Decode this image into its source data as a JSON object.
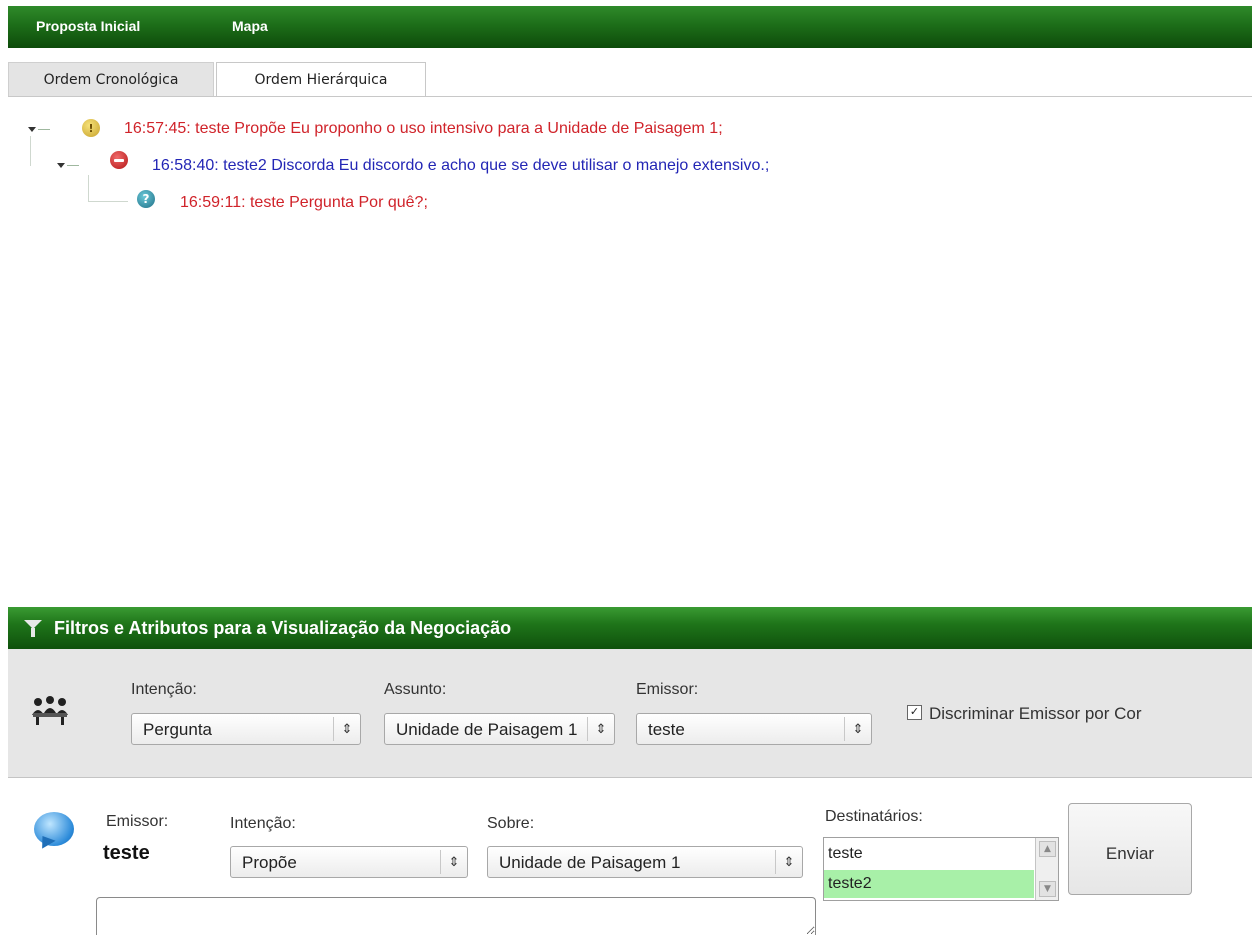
{
  "menu": {
    "items": [
      {
        "label": "Proposta Inicial"
      },
      {
        "label": "Mapa"
      }
    ]
  },
  "tabs": [
    {
      "label": "Ordem Cronológica",
      "selected": false
    },
    {
      "label": "Ordem Hierárquica",
      "selected": true
    }
  ],
  "tree": {
    "nodes": [
      {
        "text": "16:57:45: teste Propõe Eu proponho o uso intensivo para a Unidade de Paisagem 1;",
        "icon": "lightbulb-icon",
        "level": 0,
        "color": "#d0232a"
      },
      {
        "text": "16:58:40: teste2 Discorda Eu discordo e acho que se deve utilisar o manejo extensivo.;",
        "icon": "minus-circle-icon",
        "level": 1,
        "color": "#2326b5"
      },
      {
        "text": "16:59:11: teste Pergunta Por quê?;",
        "icon": "question-icon",
        "level": 2,
        "color": "#d0232a"
      }
    ]
  },
  "filter_panel": {
    "title": "Filtros e Atributos para a Visualização da Negociação",
    "intencao_label": "Intenção:",
    "intencao_value": "Pergunta",
    "assunto_label": "Assunto:",
    "assunto_value": "Unidade de Paisagem 1",
    "emissor_label": "Emissor:",
    "emissor_value": "teste",
    "discriminar_label": "Discriminar Emissor por Cor",
    "discriminar_checked": true
  },
  "compose": {
    "emissor_label": "Emissor:",
    "emissor_value": "teste",
    "intencao_label": "Intenção:",
    "intencao_value": "Propõe",
    "sobre_label": "Sobre:",
    "sobre_value": "Unidade de Paisagem 1",
    "destinatarios_label": "Destinatários:",
    "destinatarios": [
      {
        "name": "teste",
        "selected": false
      },
      {
        "name": "teste2",
        "selected": true
      }
    ],
    "send_label": "Enviar",
    "message_value": ""
  },
  "colors": {
    "header_green": "#1d6e19",
    "proposal_red": "#d0232a",
    "disagree_blue": "#2326b5",
    "selected_row_green": "#a8f0a8"
  }
}
